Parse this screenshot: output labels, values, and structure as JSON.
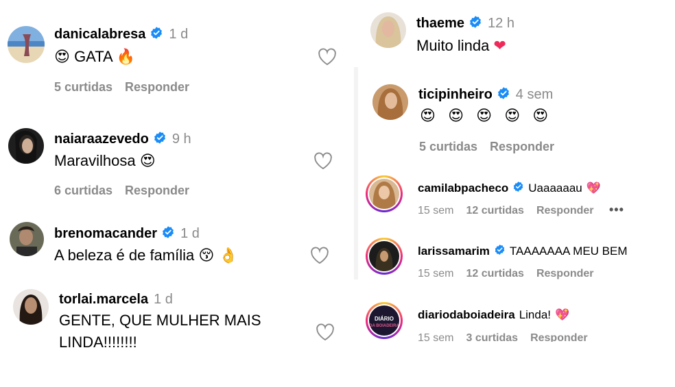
{
  "comments_left": [
    {
      "username": "danicalabresa",
      "time": "1 d",
      "text": "GATA",
      "emoji_before": "😍",
      "emoji_after": "🔥",
      "likes": "5 curtidas",
      "reply": "Responder",
      "avatar_color": "#5a86b8"
    },
    {
      "username": "naiaraazevedo",
      "time": "9 h",
      "text": "Maravilhosa",
      "emoji_after": "😍",
      "likes": "6 curtidas",
      "reply": "Responder",
      "avatar_color": "#2c2c2c"
    },
    {
      "username": "brenomacander",
      "time": "1 d",
      "text": "A beleza é de família",
      "emoji_after": "😚 👌",
      "reply": "",
      "avatar_color": "#4a4a40"
    },
    {
      "username": "torlai.marcela",
      "time": "1 d",
      "text_line1": "GENTE, QUE MULHER MAIS",
      "text_line2": "LINDA!!!!!!!!",
      "avatar_color": "#3a2a22"
    }
  ],
  "comments_right": [
    {
      "username": "thaeme",
      "time": "12 h",
      "text": "Muito linda",
      "emoji_after": "❤",
      "avatar_color": "#d8c7a8"
    },
    {
      "username": "ticipinheiro",
      "time": "4 sem",
      "emojis": [
        "😍",
        "😍",
        "😍",
        "😍",
        "😍"
      ],
      "likes": "5 curtidas",
      "reply": "Responder",
      "avatar_color": "#b5824f"
    },
    {
      "username": "camilabpacheco",
      "text": "Uaaaaaau",
      "emoji_after": "💖",
      "time": "15 sem",
      "likes": "12 curtidas",
      "reply": "Responder",
      "more": "•••",
      "avatar_color": "#c99a6a"
    },
    {
      "username": "larissamarim",
      "text": "TAAAAAAA MEU BEM",
      "time": "15 sem",
      "likes": "12 curtidas",
      "reply": "Responder",
      "avatar_color": "#222222"
    },
    {
      "username": "diariodaboiadeira",
      "text": "Linda!",
      "emoji_after": "💖",
      "time": "15 sem",
      "likes": "3 curtidas",
      "reply": "Responder",
      "avatar_color": "#1c1630",
      "avatar_text": "DIÁRIO DA BOIADEIRA"
    }
  ],
  "colors": {
    "verified": "#1a8cf7",
    "muted": "#8a8a8a",
    "heart_red": "#ee2a5a"
  }
}
